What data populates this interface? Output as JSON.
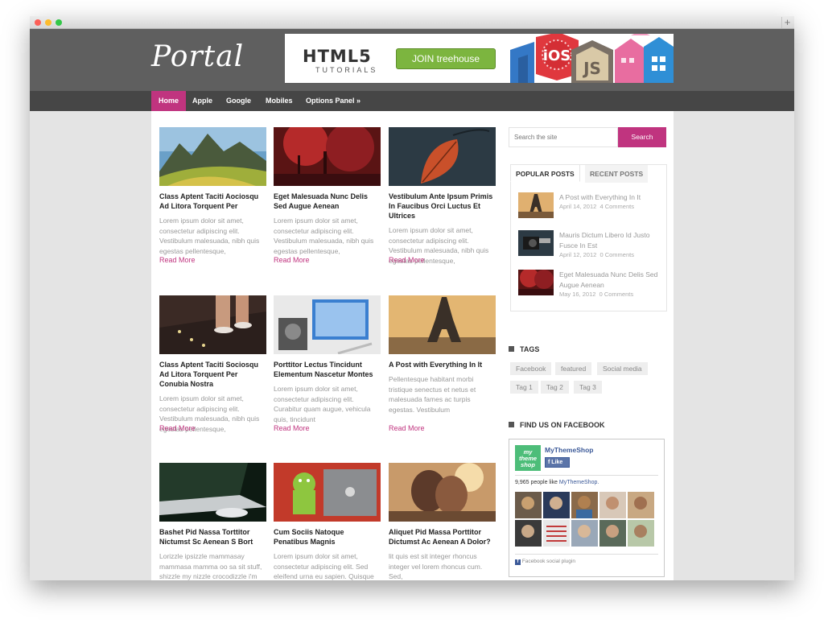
{
  "window": {
    "new_tab_label": "+"
  },
  "header": {
    "logo": "Portal"
  },
  "banner": {
    "title": "HTML5",
    "subtitle": "TUTORIALS",
    "button": "JOIN treehouse",
    "badges": [
      "iOS",
      "JS"
    ]
  },
  "nav": [
    "Home",
    "Apple",
    "Google",
    "Mobiles",
    "Options Panel »"
  ],
  "posts": [
    {
      "title": "Class Aptent Taciti Aociosqu Ad Litora Torquent Per",
      "excerpt": "Lorem ipsum dolor sit amet, consectetur adipiscing elit. Vestibulum malesuada, nibh quis egestas pellentesque,",
      "read_more": "Read More"
    },
    {
      "title": "Eget Malesuada Nunc Delis Sed Augue Aenean",
      "excerpt": "Lorem ipsum dolor sit amet, consectetur adipiscing elit. Vestibulum malesuada, nibh quis egestas pellentesque,",
      "read_more": "Read More"
    },
    {
      "title": "Vestibulum Ante Ipsum Primis In Faucibus Orci Luctus Et Ultrices",
      "excerpt": "Lorem ipsum dolor sit amet, consectetur adipiscing elit. Vestibulum malesuada, nibh quis egestas pellentesque,",
      "read_more": "Read More"
    },
    {
      "title": "Class Aptent Taciti Sociosqu Ad Litora Torquent Per Conubia Nostra",
      "excerpt": "Lorem ipsum dolor sit amet, consectetur adipiscing elit. Vestibulum malesuada, nibh quis egestas pellentesque,",
      "read_more": "Read More"
    },
    {
      "title": "Porttitor Lectus Tincidunt Elementum Nascetur Montes",
      "excerpt": "Lorem ipsum dolor sit amet, consectetur adipiscing elit. Curabitur quam augue, vehicula quis, tincidunt",
      "read_more": "Read More"
    },
    {
      "title": "A Post with Everything In It",
      "excerpt": "Pellentesque habitant morbi tristique senectus et netus et malesuada fames ac turpis egestas. Vestibulum",
      "read_more": "Read More"
    },
    {
      "title": "Bashet Pid Nassa Torttitor Nictumst Sc Aenean S Bort",
      "excerpt": "Lorizzle ipsizzle mammasay mammasa mamma oo sa sit stuff, shizzle my nizzle crocodizzle i'm",
      "read_more": ""
    },
    {
      "title": "Cum Sociis Natoque Penatibus Magnis",
      "excerpt": "Lorem ipsum dolor sit amet, consectetur adipiscing elit. Sed eleifend urna eu sapien. Quisque",
      "read_more": ""
    },
    {
      "title": "Aliquet Pid Massa Porttitor Dictumst Ac Aenean A Dolor?",
      "excerpt": "lit quis est sit integer rhoncus integer vel lorem rhoncus cum. Sed,",
      "read_more": ""
    }
  ],
  "sidebar": {
    "search": {
      "placeholder": "Search the site",
      "button": "Search"
    },
    "tabs": [
      "POPULAR POSTS",
      "RECENT POSTS"
    ],
    "popular": [
      {
        "title": "A Post with Everything In It",
        "date": "April 14, 2012",
        "comments": "4 Comments"
      },
      {
        "title": "Mauris Dictum Libero Id Justo Fusce In Est",
        "date": "April 12, 2012",
        "comments": "0 Comments"
      },
      {
        "title": "Eget Malesuada Nunc Delis Sed Augue Aenean",
        "date": "May 16, 2012",
        "comments": "0 Comments"
      }
    ],
    "tags_title": "TAGS",
    "tags": [
      "Facebook",
      "featured",
      "Social media",
      "Tag 1",
      "Tag 2",
      "Tag 3"
    ],
    "facebook": {
      "title": "FIND US ON FACEBOOK",
      "page_name": "MyThemeShop",
      "logo_text": "my theme shop",
      "like": "Like",
      "count_prefix": "9,965 people like",
      "count_link": "MyThemeShop.",
      "plugin": "Facebook social plugin"
    }
  }
}
